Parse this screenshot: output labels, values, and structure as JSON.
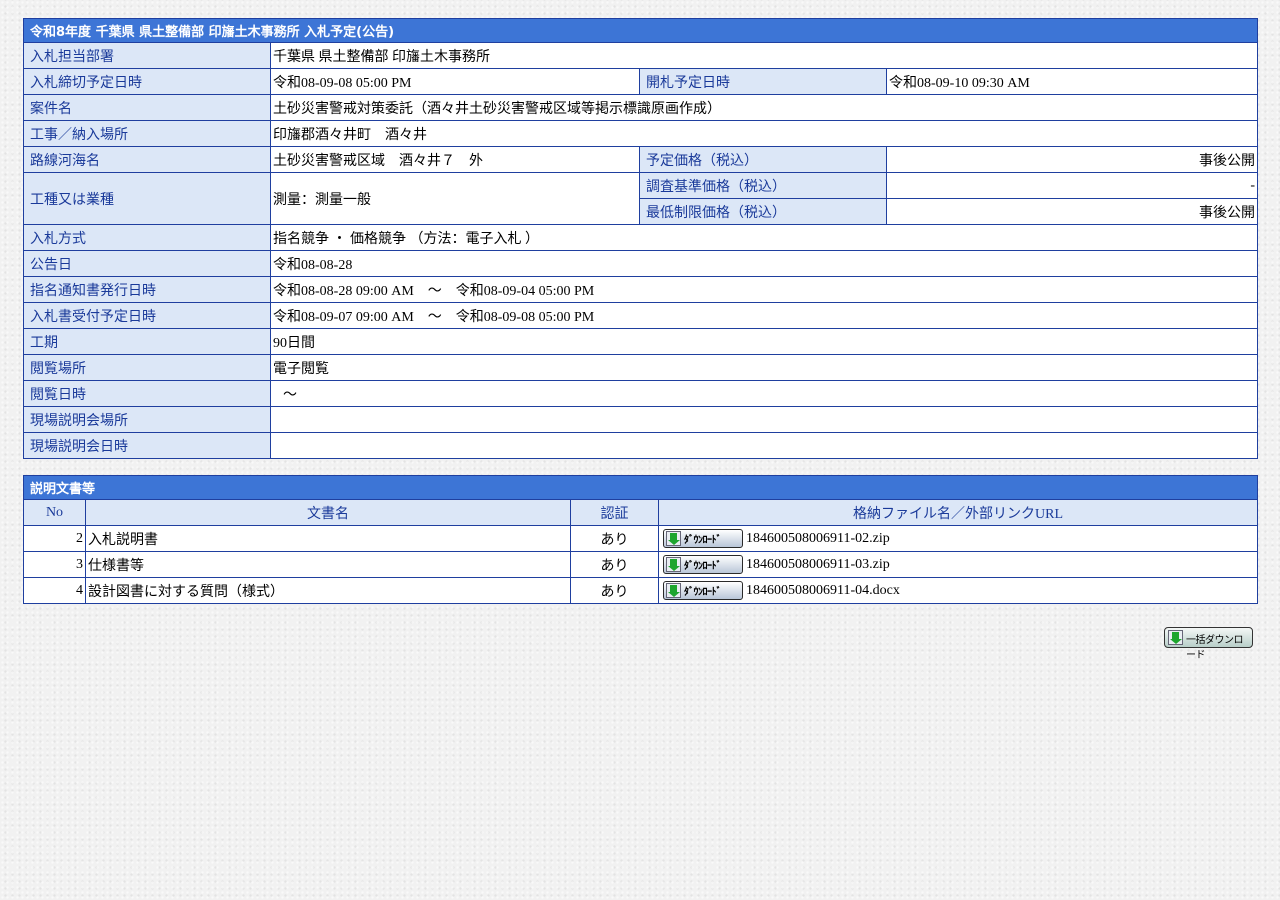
{
  "notice": {
    "title": "令和8年度 千葉県 県土整備部 印旛土木事務所 入札予定(公告)",
    "rows": {
      "dept_label": "入札担当部署",
      "dept_value": "千葉県 県土整備部 印旛土木事務所",
      "deadline_label": "入札締切予定日時",
      "deadline_value": "令和08-09-08 05:00 PM",
      "opening_label": "開札予定日時",
      "opening_value": "令和08-09-10 09:30 AM",
      "case_label": "案件名",
      "case_value": "土砂災害警戒対策委託（酒々井土砂災害警戒区域等掲示標識原画作成）",
      "place_label": "工事／納入場所",
      "place_value": "印旛郡酒々井町　酒々井",
      "route_label": "路線河海名",
      "route_value": "土砂災害警戒区域　酒々井７　外",
      "planned_price_label": "予定価格（税込）",
      "planned_price_value": "事後公開",
      "type_label": "工種又は業種",
      "type_value": "測量：測量一般",
      "survey_price_label": "調査基準価格（税込）",
      "survey_price_value": "-",
      "min_price_label": "最低制限価格（税込）",
      "min_price_value": "事後公開",
      "method_label": "入札方式",
      "method_value": "指名競争 ・ 価格競争 （方法：電子入札 ）",
      "announce_label": "公告日",
      "announce_value": "令和08-08-28",
      "notify_label": "指名通知書発行日時",
      "notify_value": "令和08-08-28 09:00 AM　～　令和08-09-04 05:00 PM",
      "receipt_label": "入札書受付予定日時",
      "receipt_value": "令和08-09-07 09:00 AM　～　令和08-09-08 05:00 PM",
      "period_label": "工期",
      "period_value": "90日間",
      "view_place_label": "閲覧場所",
      "view_place_value": "電子閲覧",
      "view_date_label": "閲覧日時",
      "view_date_value": "～",
      "site_place_label": "現場説明会場所",
      "site_place_value": "",
      "site_date_label": "現場説明会日時",
      "site_date_value": ""
    }
  },
  "documents": {
    "title": "説明文書等",
    "headers": {
      "no": "No",
      "name": "文書名",
      "auth": "認証",
      "file": "格納ファイル名／外部リンクURL"
    },
    "download_label": "ﾀﾞｳﾝﾛｰﾄﾞ",
    "items": [
      {
        "no": "2",
        "name": "入札説明書",
        "auth": "あり",
        "file": "184600508006911-02.zip"
      },
      {
        "no": "3",
        "name": "仕様書等",
        "auth": "あり",
        "file": "184600508006911-03.zip"
      },
      {
        "no": "4",
        "name": "設計図書に対する質問（様式）",
        "auth": "あり",
        "file": "184600508006911-04.docx"
      }
    ],
    "bulk_download_label": "一括ダウンロード"
  }
}
